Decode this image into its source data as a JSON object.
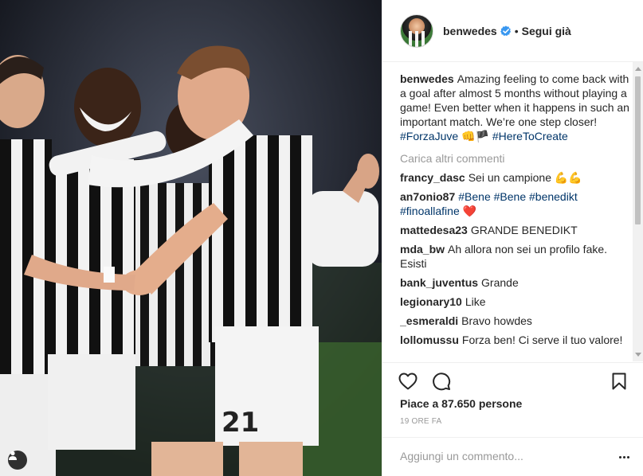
{
  "post": {
    "photo": {
      "alt_icon": "tag-users-icon",
      "jersey_number": "21"
    },
    "header": {
      "username": "benwedes",
      "follow_status": "Segui già",
      "separator": "•"
    },
    "caption": {
      "username": "benwedes",
      "text": "Amazing feeling to come back with a goal after almost 5 months without playing a game! Even better when it happens in such an important match. We’re one step closer!",
      "hashtag_1": "#ForzaJuve",
      "emoji": "👊🏴",
      "hashtag_2": "#HereToCreate"
    },
    "load_more": "Carica altri commenti",
    "comments": [
      {
        "user": "francy_dasc",
        "text": "Sei un campione 💪💪"
      },
      {
        "user": "an7onio87",
        "tags": [
          "#Bene",
          "#Bene",
          "#benedikt",
          "#finoallafine"
        ],
        "emoji": "❤️"
      },
      {
        "user": "mattedesa23",
        "text": "GRANDE BENEDIKT"
      },
      {
        "user": "mda_bw",
        "text": "Ah allora non sei un profilo fake. Esisti"
      },
      {
        "user": "bank_juventus",
        "text": "Grande"
      },
      {
        "user": "legionary10",
        "text": "Like"
      },
      {
        "user": "_esmeraldi",
        "text": "Bravo howdes"
      },
      {
        "user": "lollomussu",
        "text": "Forza ben! Ci serve il tuo valore!"
      }
    ],
    "actions": {
      "like_icon": "heart-icon",
      "comment_icon": "comment-icon",
      "save_icon": "bookmark-icon"
    },
    "likes": "Piace a 87.650 persone",
    "timestamp": "19 ORE FA",
    "add_comment": {
      "placeholder": "Aggiungi un commento...",
      "more_icon": "more-options-icon"
    },
    "colors": {
      "hashtag": "#003569",
      "verified": "#3897f0",
      "muted": "#999999",
      "text": "#262626"
    }
  }
}
